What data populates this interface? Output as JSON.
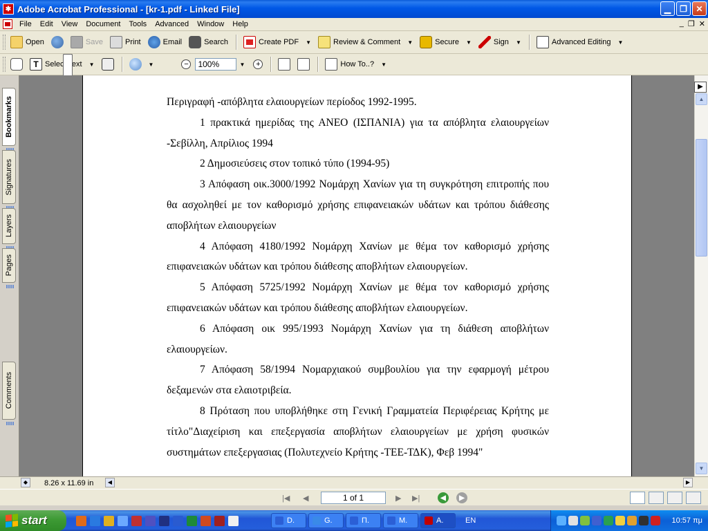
{
  "window": {
    "title": "Adobe Acrobat Professional - [kr-1.pdf - Linked File]",
    "icon": "acrobat-icon"
  },
  "menu": [
    "File",
    "Edit",
    "View",
    "Document",
    "Tools",
    "Advanced",
    "Window",
    "Help"
  ],
  "toolbar1": {
    "open": "Open",
    "save": "Save",
    "print": "Print",
    "email": "Email",
    "search": "Search",
    "create_pdf": "Create PDF",
    "review": "Review & Comment",
    "secure": "Secure",
    "sign": "Sign",
    "advanced_editing": "Advanced Editing"
  },
  "toolbar2": {
    "select_text": "Select Text",
    "zoom": "100%",
    "how_to": "How To..?"
  },
  "nav_tabs": [
    "Bookmarks",
    "Signatures",
    "Layers",
    "Pages",
    "Comments"
  ],
  "document": {
    "paragraphs": [
      {
        "text": "Περιγραφή -απόβλητα ελαιουργείων περίοδος 1992-1995.",
        "indent": false
      },
      {
        "text": "1 πρακτικά ημερίδας της ΑΝΕΟ (ΙΣΠΑΝΙΑ) για τα απόβλητα ελαιουργείων -Σεβίλλη, Απρίλιος 1994",
        "indent": true
      },
      {
        "text": "2 Δημοσιεύσεις στον τοπικό τύπο (1994-95)",
        "indent": true
      },
      {
        "text": "3 Απόφαση οικ.3000/1992 Νομάρχη Χανίων για τη συγκρότηση επιτροπής που θα ασχοληθεί με τον καθορισμό χρήσης επιφανειακών υδάτων και τρόπου διάθεσης αποβλήτων ελαιουργείων",
        "indent": true
      },
      {
        "text": "4 Απόφαση 4180/1992 Νομάρχη Χανίων με θέμα τον καθορισμό χρήσης επιφανειακών υδάτων και τρόπου διάθεσης αποβλήτων ελαιουργείων.",
        "indent": true
      },
      {
        "text": "5 Απόφαση 5725/1992 Νομάρχη Χανίων με θέμα τον καθορισμό χρήσης επιφανειακών υδάτων και τρόπου διάθεσης αποβλήτων ελαιουργείων.",
        "indent": true
      },
      {
        "text": "6 Απόφαση οικ 995/1993 Νομάρχη Χανίων για τη διάθεση αποβλήτων ελαιουργείων.",
        "indent": true
      },
      {
        "text": "7 Απόφαση 58/1994 Νομαρχιακού συμβουλίου για την εφαρμογή μέτρου δεξαμενών στα ελαιοτριβεία.",
        "indent": true
      },
      {
        "text": "8 Πρόταση που υποβλήθηκε στη Γενική Γραμματεία Περιφέρειας Κρήτης με τίτλο\"Διαχείριση και επεξεργασία αποβλήτων ελαιουργείων με χρήση φυσικών συστημάτων επεξεργασιας (Πολυτεχνείο Κρήτης -ΤΕΕ-ΤΔΚ), Φεβ 1994\"",
        "indent": true
      }
    ]
  },
  "status": {
    "page_size": "8.26 x 11.69 in",
    "page_indicator": "1 of 1"
  },
  "taskbar": {
    "start": "start",
    "tasks": [
      {
        "label": "D.",
        "color": "#2b5fd6"
      },
      {
        "label": "G.",
        "color": "#3a8ae8"
      },
      {
        "label": "Π.",
        "color": "#2b5fd6"
      },
      {
        "label": "M.",
        "color": "#2b5fd6"
      },
      {
        "label": "A.",
        "color": "#c00000"
      }
    ],
    "language": "EN",
    "clock": "10:57 πμ"
  },
  "colors": {
    "titlebar": "#0058e6",
    "page_bg": "#808080",
    "taskbar": "#245edb",
    "start": "#3d9a34"
  }
}
